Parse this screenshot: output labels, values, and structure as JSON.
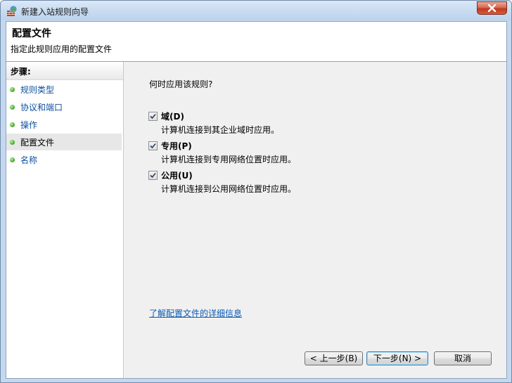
{
  "window": {
    "title": "新建入站规则向导"
  },
  "header": {
    "title": "配置文件",
    "subtitle": "指定此规则应用的配置文件"
  },
  "steps": {
    "heading": "步骤:",
    "items": [
      {
        "label": "规则类型",
        "current": false
      },
      {
        "label": "协议和端口",
        "current": false
      },
      {
        "label": "操作",
        "current": false
      },
      {
        "label": "配置文件",
        "current": true
      },
      {
        "label": "名称",
        "current": false
      }
    ]
  },
  "main": {
    "question": "何时应用该规则?",
    "options": [
      {
        "label": "域(D)",
        "description": "计算机连接到其企业域时应用。",
        "checked": true
      },
      {
        "label": "专用(P)",
        "description": "计算机连接到专用网络位置时应用。",
        "checked": true
      },
      {
        "label": "公用(U)",
        "description": "计算机连接到公用网络位置时应用。",
        "checked": true
      }
    ],
    "learn_more_link": "了解配置文件的详细信息"
  },
  "buttons": {
    "back": "< 上一步(B)",
    "next": "下一步(N) >",
    "cancel": "取消"
  },
  "icons": {
    "app": "firewall-icon",
    "close": "close-icon",
    "check": "check-icon",
    "step": "green-dot-icon"
  }
}
